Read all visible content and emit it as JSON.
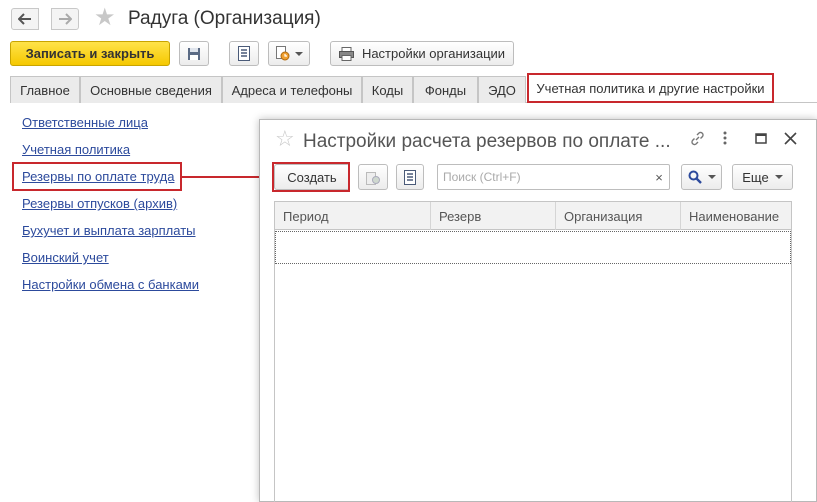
{
  "window": {
    "title": "Радуга (Организация)"
  },
  "toolbar": {
    "save_close_label": "Записать и закрыть",
    "org_settings_label": "Настройки организации"
  },
  "tabs": [
    {
      "label": "Главное",
      "active": false
    },
    {
      "label": "Основные сведения",
      "active": false
    },
    {
      "label": "Адреса и телефоны",
      "active": false
    },
    {
      "label": "Коды",
      "active": false
    },
    {
      "label": "Фонды",
      "active": false
    },
    {
      "label": "ЭДО",
      "active": false
    },
    {
      "label": "Учетная политика и другие настройки",
      "active": true
    }
  ],
  "sidebar": {
    "items": [
      {
        "label": "Ответственные лица"
      },
      {
        "label": "Учетная политика"
      },
      {
        "label": "Резервы по оплате труда"
      },
      {
        "label": "Резервы отпусков (архив)"
      },
      {
        "label": "Бухучет и выплата зарплаты"
      },
      {
        "label": "Воинский учет"
      },
      {
        "label": "Настройки обмена с банками"
      }
    ]
  },
  "dialog": {
    "title": "Настройки расчета резервов по оплате ...",
    "create_label": "Создать",
    "search_placeholder": "Поиск (Ctrl+F)",
    "search_clear": "×",
    "more_label": "Еще",
    "columns": [
      "Период",
      "Резерв",
      "Организация",
      "Наименование"
    ]
  },
  "colors": {
    "highlight": "#c8282d",
    "primary_button": "#f5c800",
    "link": "#2c4a9c"
  }
}
